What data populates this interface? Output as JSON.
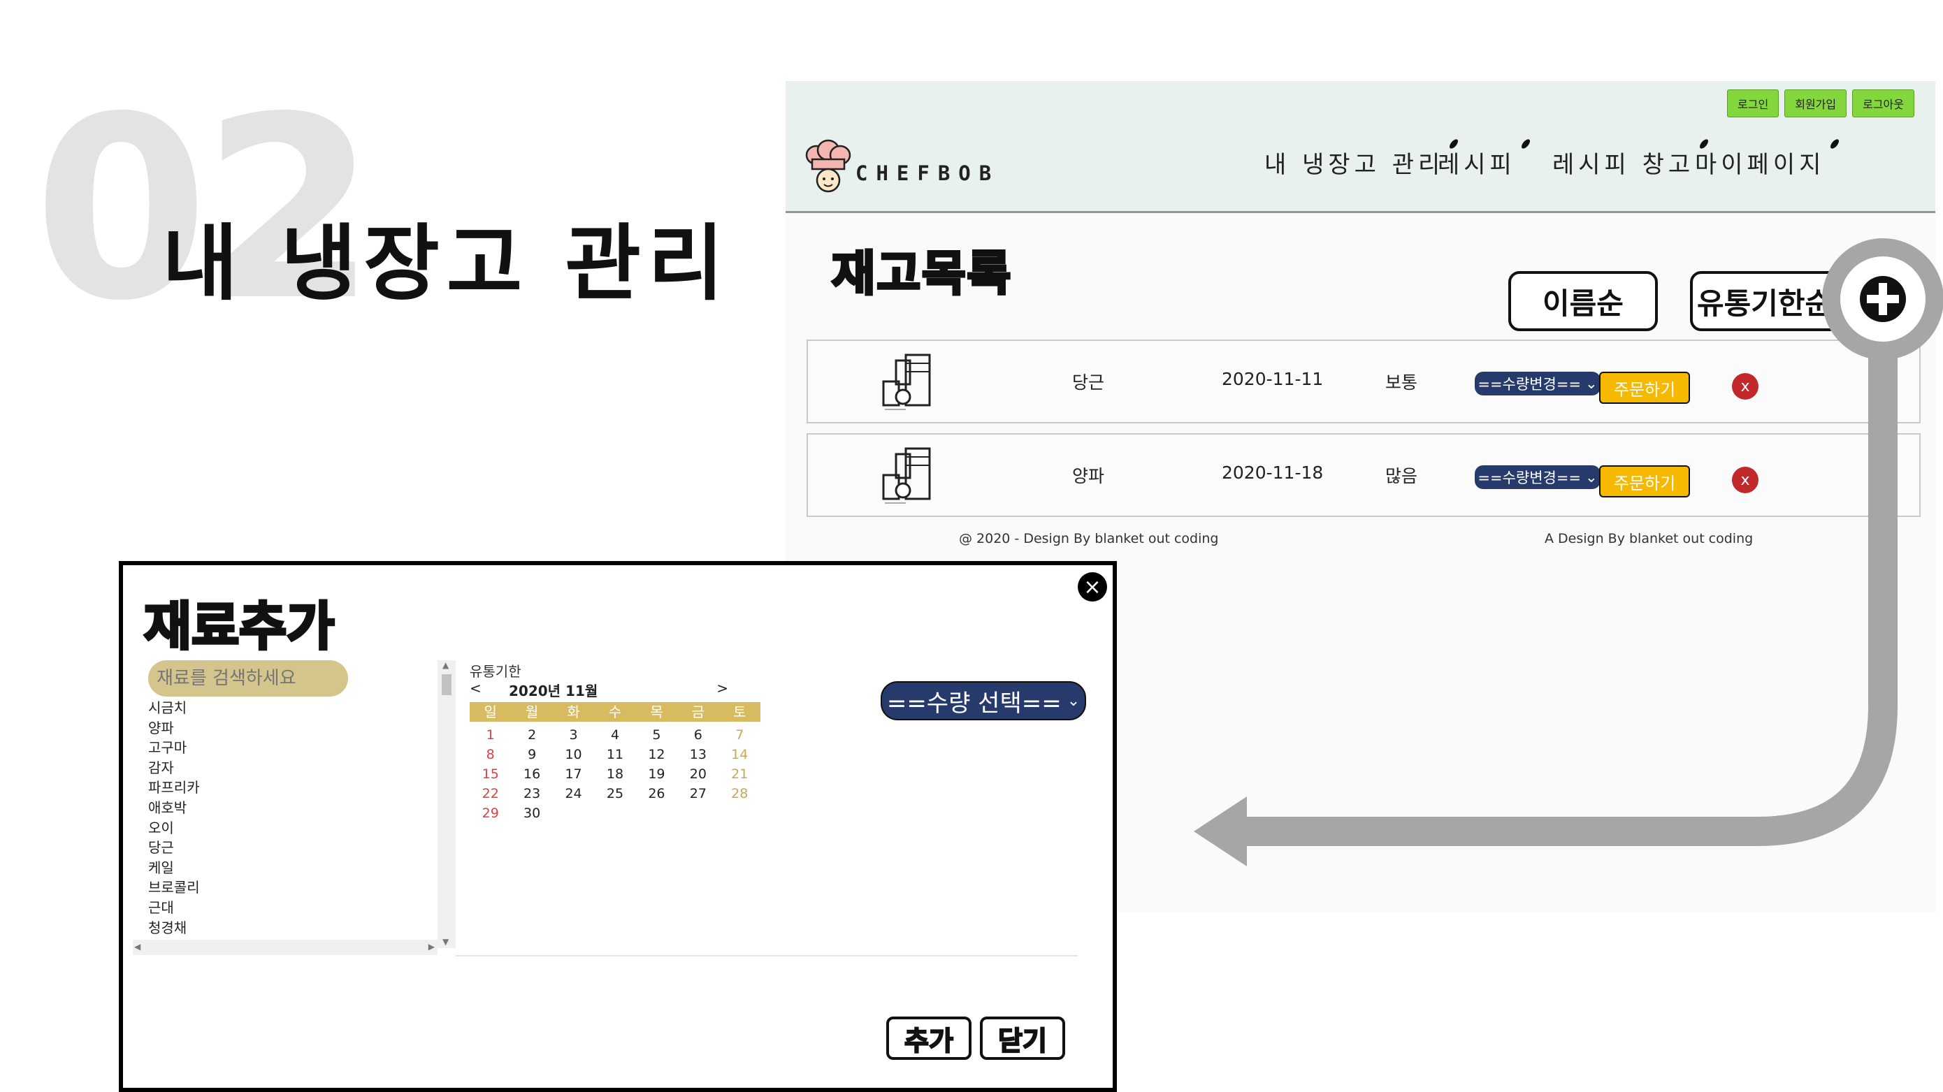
{
  "slide": {
    "number": "02",
    "title": "내 냉장고 관리"
  },
  "header": {
    "auth": [
      "로그인",
      "회원가입",
      "로그아웃"
    ],
    "logo": "CHEFBOB",
    "nav": [
      "내 냉장고 관리",
      "레시피",
      "레시피 창고",
      "마이페이지"
    ]
  },
  "stock": {
    "title": "재고목록",
    "sort_name": "이름순",
    "sort_expiry": "유통기한순",
    "add_icon": "plus-circle-icon",
    "qty_label": "==수량변경==",
    "order_label": "주문하기",
    "delete_label": "x",
    "rows": [
      {
        "name": "당근",
        "date": "2020-11-11",
        "level": "보통"
      },
      {
        "name": "양파",
        "date": "2020-11-18",
        "level": "많음"
      }
    ]
  },
  "footer": {
    "left": "@ 2020 - Design By blanket out coding",
    "right": "A Design By blanket out coding"
  },
  "modal": {
    "title": "재료추가",
    "close": "×",
    "search_placeholder": "재료를 검색하세요",
    "materials": [
      "시금치",
      "양파",
      "고구마",
      "감자",
      "파프리카",
      "애호박",
      "오이",
      "당근",
      "케일",
      "브로콜리",
      "근대",
      "청경채"
    ],
    "expiry_label": "유통기한",
    "calendar": {
      "prev": "<",
      "month": "2020년 11월",
      "next": ">",
      "weekdays": [
        "일",
        "월",
        "화",
        "수",
        "목",
        "금",
        "토"
      ],
      "days": [
        "1",
        "2",
        "3",
        "4",
        "5",
        "6",
        "7",
        "8",
        "9",
        "10",
        "11",
        "12",
        "13",
        "14",
        "15",
        "16",
        "17",
        "18",
        "19",
        "20",
        "21",
        "22",
        "23",
        "24",
        "25",
        "26",
        "27",
        "28",
        "29",
        "30"
      ]
    },
    "qty_select": "==수량 선택==",
    "add_button": "추가",
    "close_button": "닫기"
  },
  "colors": {
    "header_bg": "#e9f1ef",
    "auth_green": "#84d63d",
    "select_navy": "#263a6c",
    "order_yellow": "#f7b800",
    "delete_red": "#c1282a",
    "calendar_gold": "#d8bb60",
    "search_tan": "#d4c58d",
    "arrow_gray": "#a6a6a6"
  }
}
